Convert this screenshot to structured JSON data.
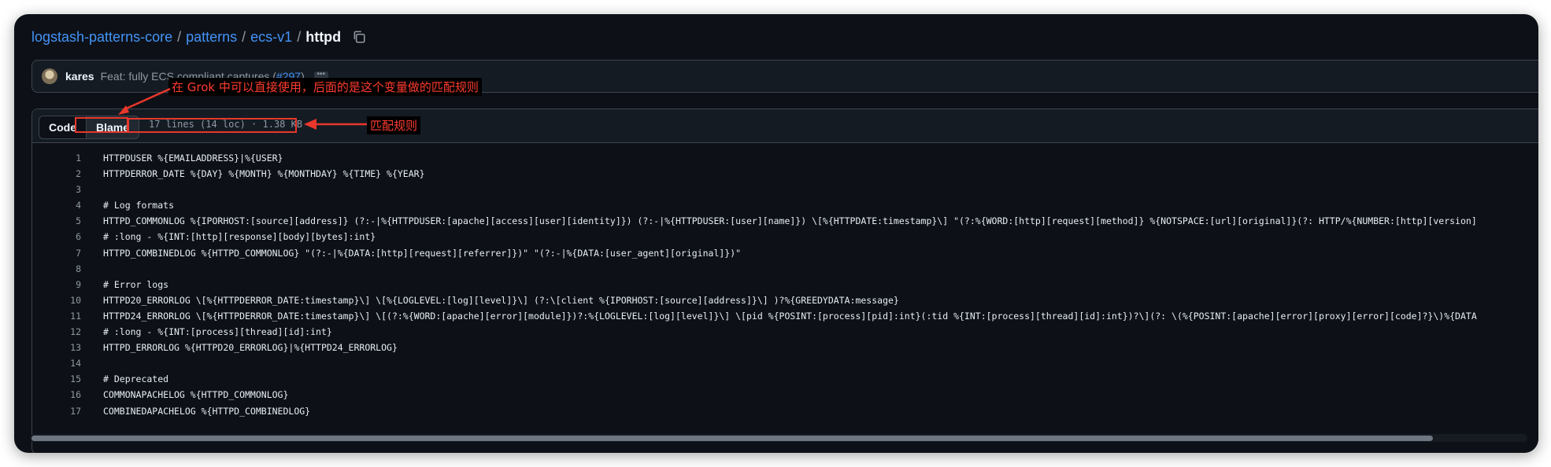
{
  "breadcrumb": {
    "repo": "logstash-patterns-core",
    "sep": "/",
    "dir1": "patterns",
    "dir2": "ecs-v1",
    "file": "httpd"
  },
  "commit": {
    "author": "kares",
    "message": "Feat: fully ECS compliant captures (",
    "pr": "#297",
    "message_end": ")"
  },
  "toolbar": {
    "code_label": "Code",
    "blame_label": "Blame",
    "file_info": "17 lines (14 loc) · 1.38 KB"
  },
  "code_lines": [
    {
      "n": "1",
      "text": "HTTPDUSER %{EMAILADDRESS}|%{USER}"
    },
    {
      "n": "2",
      "text": "HTTPDERROR_DATE %{DAY} %{MONTH} %{MONTHDAY} %{TIME} %{YEAR}"
    },
    {
      "n": "3",
      "text": ""
    },
    {
      "n": "4",
      "text": "# Log formats"
    },
    {
      "n": "5",
      "text": "HTTPD_COMMONLOG %{IPORHOST:[source][address]} (?:-|%{HTTPDUSER:[apache][access][user][identity]}) (?:-|%{HTTPDUSER:[user][name]}) \\[%{HTTPDATE:timestamp}\\] \"(?:%{WORD:[http][request][method]} %{NOTSPACE:[url][original]}(?: HTTP/%{NUMBER:[http][version]"
    },
    {
      "n": "6",
      "text": "# :long - %{INT:[http][response][body][bytes]:int}"
    },
    {
      "n": "7",
      "text": "HTTPD_COMBINEDLOG %{HTTPD_COMMONLOG} \"(?:-|%{DATA:[http][request][referrer]})\" \"(?:-|%{DATA:[user_agent][original]})\""
    },
    {
      "n": "8",
      "text": ""
    },
    {
      "n": "9",
      "text": "# Error logs"
    },
    {
      "n": "10",
      "text": "HTTPD20_ERRORLOG \\[%{HTTPDERROR_DATE:timestamp}\\] \\[%{LOGLEVEL:[log][level]}\\] (?:\\[client %{IPORHOST:[source][address]}\\] )?%{GREEDYDATA:message}"
    },
    {
      "n": "11",
      "text": "HTTPD24_ERRORLOG \\[%{HTTPDERROR_DATE:timestamp}\\] \\[(?:%{WORD:[apache][error][module]})?:%{LOGLEVEL:[log][level]}\\] \\[pid %{POSINT:[process][pid]:int}(:tid %{INT:[process][thread][id]:int})?\\](?: \\(%{POSINT:[apache][error][proxy][error][code]?}\\)%{DATA"
    },
    {
      "n": "12",
      "text": "# :long - %{INT:[process][thread][id]:int}"
    },
    {
      "n": "13",
      "text": "HTTPD_ERRORLOG %{HTTPD20_ERRORLOG}|%{HTTPD24_ERRORLOG}"
    },
    {
      "n": "14",
      "text": ""
    },
    {
      "n": "15",
      "text": "# Deprecated"
    },
    {
      "n": "16",
      "text": "COMMONAPACHELOG %{HTTPD_COMMONLOG}"
    },
    {
      "n": "17",
      "text": "COMBINEDAPACHELOG %{HTTPD_COMBINEDLOG}"
    }
  ],
  "annotations": {
    "top_note": "在 Grok 中可以直接使用，后面的是这个变量做的匹配规则",
    "right_note": "匹配规则"
  },
  "colors": {
    "bg": "#0d1117",
    "accent_link": "#4493f8",
    "annotation_red": "#e8372b"
  }
}
